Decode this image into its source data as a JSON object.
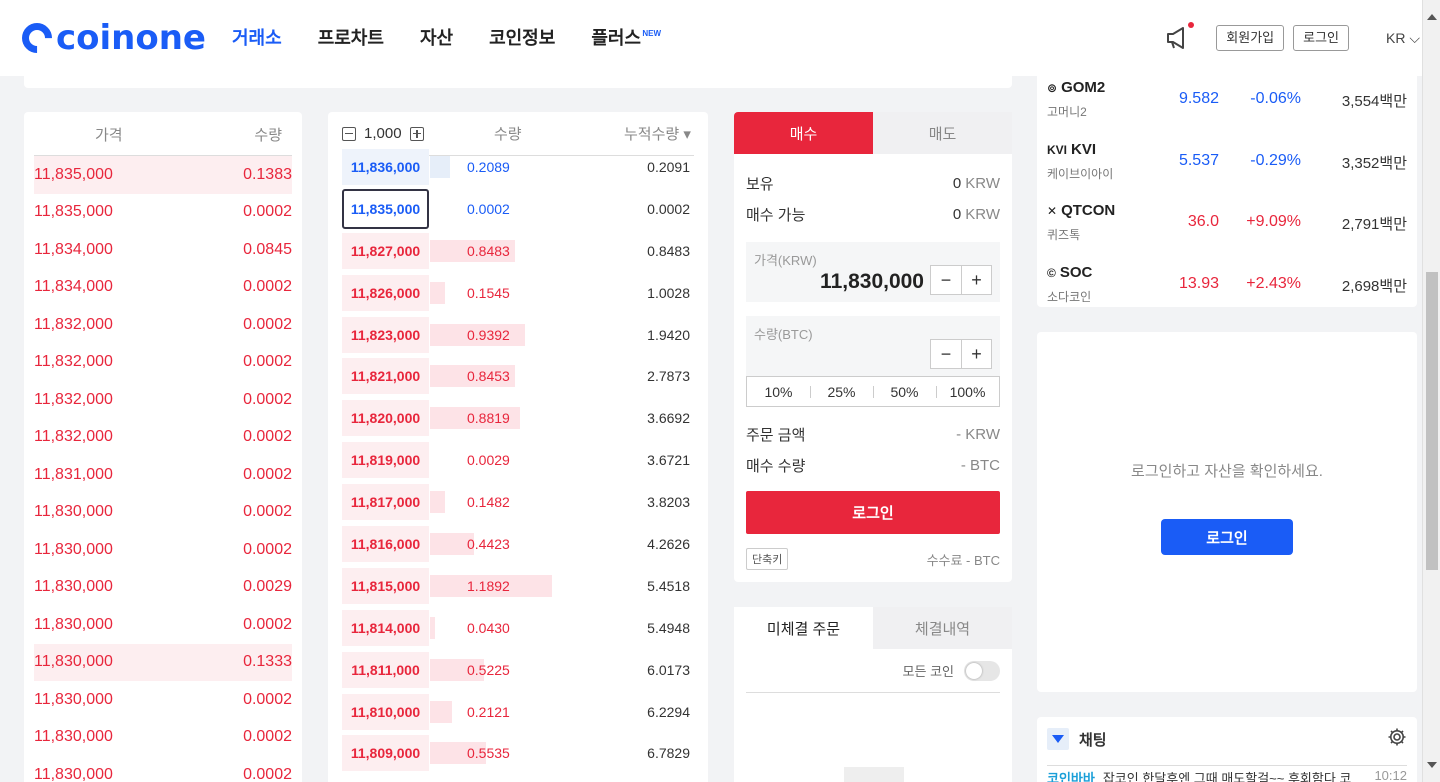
{
  "header": {
    "logo_text": "coinone",
    "nav": [
      {
        "label": "거래소",
        "active": true
      },
      {
        "label": "프로차트",
        "active": false
      },
      {
        "label": "자산",
        "active": false
      },
      {
        "label": "코인정보",
        "active": false
      },
      {
        "label": "플러스",
        "active": false,
        "badge": "NEW"
      }
    ],
    "signup": "회원가입",
    "login": "로그인",
    "lang": "KR"
  },
  "trades": {
    "col_price": "가격",
    "col_qty": "수량",
    "rows": [
      {
        "price": "11,835,000",
        "qty": "0.1383",
        "hl": true
      },
      {
        "price": "11,835,000",
        "qty": "0.0002"
      },
      {
        "price": "11,834,000",
        "qty": "0.0845"
      },
      {
        "price": "11,834,000",
        "qty": "0.0002"
      },
      {
        "price": "11,832,000",
        "qty": "0.0002"
      },
      {
        "price": "11,832,000",
        "qty": "0.0002"
      },
      {
        "price": "11,832,000",
        "qty": "0.0002"
      },
      {
        "price": "11,832,000",
        "qty": "0.0002"
      },
      {
        "price": "11,831,000",
        "qty": "0.0002"
      },
      {
        "price": "11,830,000",
        "qty": "0.0002"
      },
      {
        "price": "11,830,000",
        "qty": "0.0002"
      },
      {
        "price": "11,830,000",
        "qty": "0.0029"
      },
      {
        "price": "11,830,000",
        "qty": "0.0002"
      },
      {
        "price": "11,830,000",
        "qty": "0.1333",
        "hl": true
      },
      {
        "price": "11,830,000",
        "qty": "0.0002"
      },
      {
        "price": "11,830,000",
        "qty": "0.0002"
      },
      {
        "price": "11,830,000",
        "qty": "0.0002"
      }
    ]
  },
  "orderbook": {
    "unit": "1,000",
    "col_qty": "수량",
    "col_cum": "누적수량",
    "rows": [
      {
        "price": "11,836,000",
        "qty": "0.2089",
        "cum": "0.2091",
        "side": "buy",
        "fill": 0.08
      },
      {
        "price": "11,835,000",
        "qty": "0.0002",
        "cum": "0.0002",
        "side": "buy",
        "fill": 0,
        "selected": true
      },
      {
        "price": "11,827,000",
        "qty": "0.8483",
        "cum": "0.8483",
        "side": "sell",
        "fill": 0.35
      },
      {
        "price": "11,826,000",
        "qty": "0.1545",
        "cum": "1.0028",
        "side": "sell",
        "fill": 0.06
      },
      {
        "price": "11,823,000",
        "qty": "0.9392",
        "cum": "1.9420",
        "side": "sell",
        "fill": 0.39
      },
      {
        "price": "11,821,000",
        "qty": "0.8453",
        "cum": "2.7873",
        "side": "sell",
        "fill": 0.35
      },
      {
        "price": "11,820,000",
        "qty": "0.8819",
        "cum": "3.6692",
        "side": "sell",
        "fill": 0.37
      },
      {
        "price": "11,819,000",
        "qty": "0.0029",
        "cum": "3.6721",
        "side": "sell",
        "fill": 0
      },
      {
        "price": "11,817,000",
        "qty": "0.1482",
        "cum": "3.8203",
        "side": "sell",
        "fill": 0.06
      },
      {
        "price": "11,816,000",
        "qty": "0.4423",
        "cum": "4.2626",
        "side": "sell",
        "fill": 0.18
      },
      {
        "price": "11,815,000",
        "qty": "1.1892",
        "cum": "5.4518",
        "side": "sell",
        "fill": 0.5
      },
      {
        "price": "11,814,000",
        "qty": "0.0430",
        "cum": "5.4948",
        "side": "sell",
        "fill": 0.02
      },
      {
        "price": "11,811,000",
        "qty": "0.5225",
        "cum": "6.0173",
        "side": "sell",
        "fill": 0.22
      },
      {
        "price": "11,810,000",
        "qty": "0.2121",
        "cum": "6.2294",
        "side": "sell",
        "fill": 0.09
      },
      {
        "price": "11,809,000",
        "qty": "0.5535",
        "cum": "6.7829",
        "side": "sell",
        "fill": 0.23
      }
    ]
  },
  "order_form": {
    "tab_buy": "매수",
    "tab_sell": "매도",
    "holding_label": "보유",
    "holding_value": "0",
    "holding_unit": "KRW",
    "avail_label": "매수 가능",
    "avail_value": "0",
    "avail_unit": "KRW",
    "price_label": "가격(KRW)",
    "price_value": "11,830,000",
    "qty_label": "수량(BTC)",
    "qty_value": "",
    "pct": [
      "10%",
      "25%",
      "50%",
      "100%"
    ],
    "order_amount_label": "주문 금액",
    "order_amount_value": "- KRW",
    "buy_qty_label": "매수 수량",
    "buy_qty_value": "- BTC",
    "login_btn": "로그인",
    "shortcut": "단축키",
    "fee": "수수료 - BTC"
  },
  "open_orders": {
    "tab_open": "미체결 주문",
    "tab_filled": "체결내역",
    "all_coins": "모든 코인"
  },
  "coins": [
    {
      "icon": "⊚",
      "symbol": "GOM2",
      "name": "고머니2",
      "price": "9.582",
      "change": "-0.06%",
      "volume": "3,554백만",
      "dir": "down"
    },
    {
      "icon": "KVI",
      "symbol": "KVI",
      "name": "케이브이아이",
      "price": "5.537",
      "change": "-0.29%",
      "volume": "3,352백만",
      "dir": "down"
    },
    {
      "icon": "✕",
      "symbol": "QTCON",
      "name": "퀴즈톡",
      "price": "36.0",
      "change": "+9.09%",
      "volume": "2,791백만",
      "dir": "up"
    },
    {
      "icon": "©",
      "symbol": "SOC",
      "name": "소다코인",
      "price": "13.93",
      "change": "+2.43%",
      "volume": "2,698백만",
      "dir": "up"
    }
  ],
  "assets": {
    "message": "로그인하고 자산을 확인하세요.",
    "login_btn": "로그인"
  },
  "chat": {
    "title": "채팅",
    "user": "코인바바",
    "message": "잡코인 한달후엔 그때 매도할걸~~ 후회함다 코",
    "time": "10:12"
  }
}
